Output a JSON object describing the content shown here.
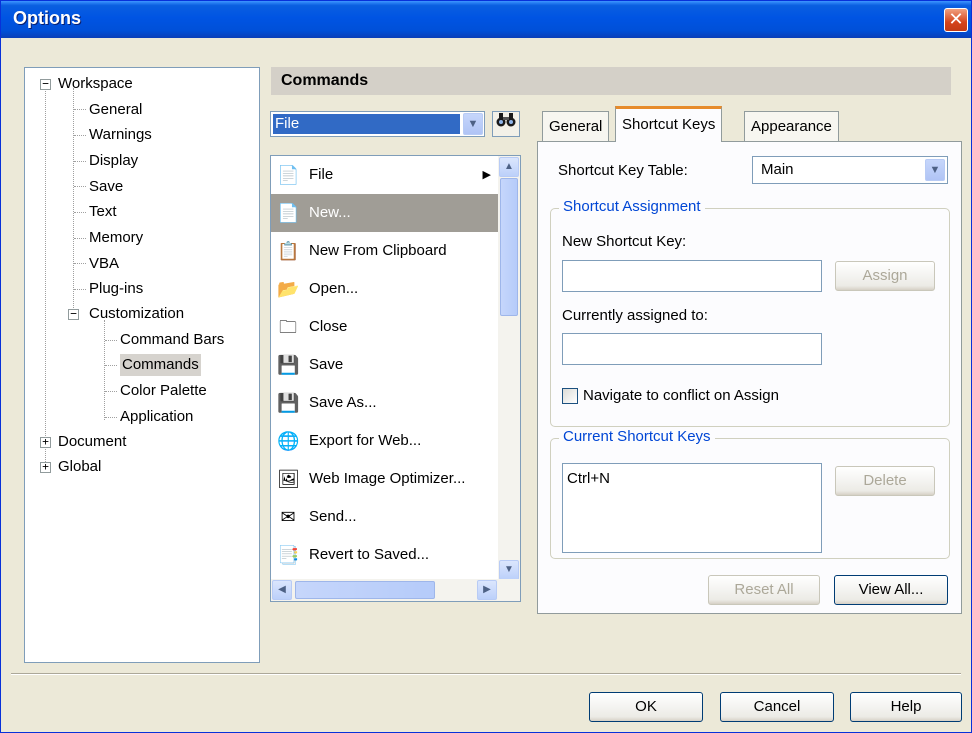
{
  "window": {
    "title": "Options",
    "close_glyph": "✕"
  },
  "tree": {
    "items": [
      {
        "label": "Workspace",
        "expander": "−"
      },
      {
        "label": "General"
      },
      {
        "label": "Warnings"
      },
      {
        "label": "Display"
      },
      {
        "label": "Save"
      },
      {
        "label": "Text"
      },
      {
        "label": "Memory"
      },
      {
        "label": "VBA"
      },
      {
        "label": "Plug-ins"
      },
      {
        "label": "Customization",
        "expander": "−"
      },
      {
        "label": "Command Bars"
      },
      {
        "label": "Commands",
        "selected": true
      },
      {
        "label": "Color Palette"
      },
      {
        "label": "Application"
      },
      {
        "label": "Document",
        "expander": "+"
      },
      {
        "label": "Global",
        "expander": "+"
      }
    ]
  },
  "commands": {
    "header": "Commands",
    "category_value": "File",
    "find_icon": "binoculars-icon",
    "list": [
      {
        "label": "File",
        "icon": "📄",
        "submenu": true
      },
      {
        "label": "New...",
        "icon": "📄",
        "selected": true
      },
      {
        "label": "New From Clipboard",
        "icon": "📋"
      },
      {
        "label": "Open...",
        "icon": "📂"
      },
      {
        "label": "Close",
        "icon": "🗀"
      },
      {
        "label": "Save",
        "icon": "💾"
      },
      {
        "label": "Save As...",
        "icon": "💾"
      },
      {
        "label": "Export for Web...",
        "icon": "🌐"
      },
      {
        "label": "Web Image Optimizer...",
        "icon": "🖼"
      },
      {
        "label": "Send...",
        "icon": "✉"
      },
      {
        "label": "Revert to Saved...",
        "icon": "📑"
      }
    ]
  },
  "tabs": [
    {
      "label": "General"
    },
    {
      "label": "Shortcut Keys",
      "active": true
    },
    {
      "label": "Appearance"
    }
  ],
  "shortcut": {
    "table_label": "Shortcut Key Table:",
    "table_value": "Main",
    "assignment_group": "Shortcut Assignment",
    "new_key_label": "New Shortcut Key:",
    "new_key_value": "",
    "assign_button": "Assign",
    "assigned_label": "Currently assigned to:",
    "assigned_value": "",
    "navigate_label": "Navigate to conflict on Assign",
    "current_group": "Current Shortcut Keys",
    "current_keys": "Ctrl+N",
    "delete_button": "Delete",
    "reset_all_button": "Reset All",
    "view_all_button": "View All..."
  },
  "footer": {
    "ok": "OK",
    "cancel": "Cancel",
    "help": "Help"
  }
}
